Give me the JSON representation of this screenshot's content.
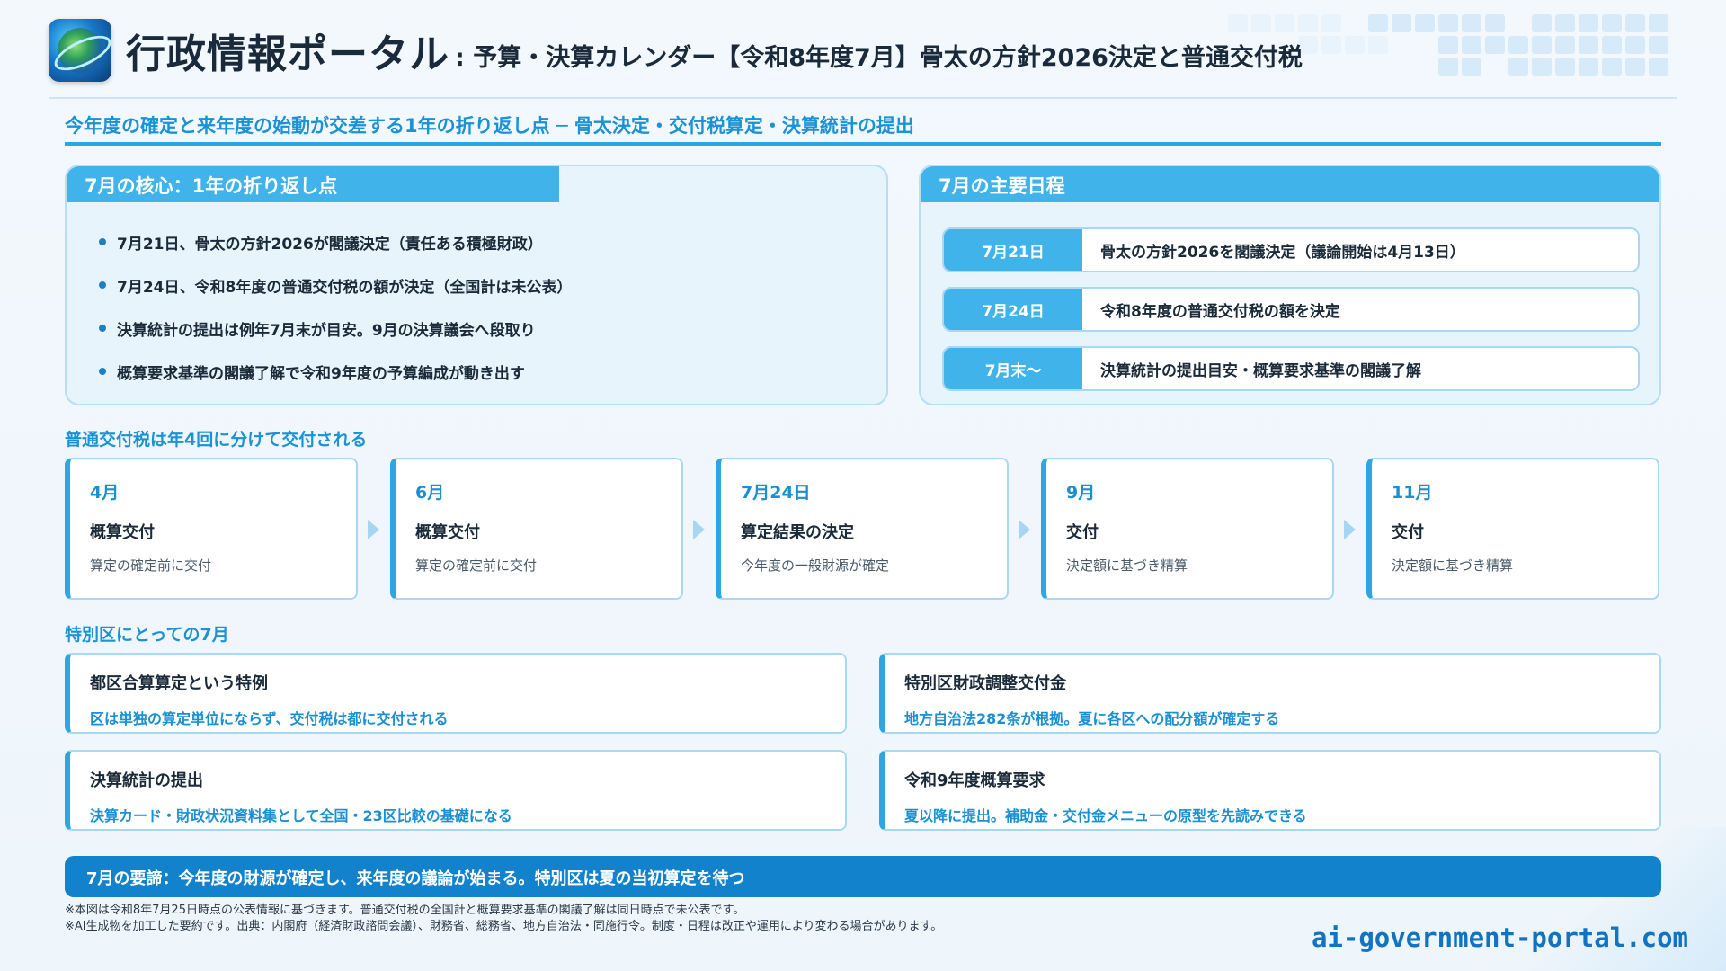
{
  "header": {
    "brand": "行政情報ポータル",
    "subtitle": ": 予算・決算カレンダー【令和8年度7月】骨太の方針2026決定と普通交付税",
    "logo_icon": "globe-logo-icon"
  },
  "tagline": "今年度の確定と来年度の始動が交差する1年の折り返し点 ─ 骨太決定・交付税算定・決算統計の提出",
  "core": {
    "heading": "7月の核心：1年の折り返し点",
    "bullets": [
      "7月21日、骨太の方針2026が閣議決定（責任ある積極財政）",
      "7月24日、令和8年度の普通交付税の額が決定（全国計は未公表）",
      "決算統計の提出は例年7月末が目安。9月の決算議会へ段取り",
      "概算要求基準の閣議了解で令和9年度の予算編成が動き出す"
    ]
  },
  "schedule": {
    "heading": "7月の主要日程",
    "rows": [
      {
        "date": "7月21日",
        "text": "骨太の方針2026を閣議決定（議論開始は4月13日）"
      },
      {
        "date": "7月24日",
        "text": "令和8年度の普通交付税の額を決定"
      },
      {
        "date": "7月末〜",
        "text": "決算統計の提出目安・概算要求基準の閣議了解"
      }
    ]
  },
  "flow": {
    "heading": "普通交付税は年4回に分けて交付される",
    "cards": [
      {
        "month": "4月",
        "title": "概算交付",
        "desc": "算定の確定前に交付"
      },
      {
        "month": "6月",
        "title": "概算交付",
        "desc": "算定の確定前に交付"
      },
      {
        "month": "7月24日",
        "title": "算定結果の決定",
        "desc": "今年度の一般財源が確定"
      },
      {
        "month": "9月",
        "title": "交付",
        "desc": "決定額に基づき精算"
      },
      {
        "month": "11月",
        "title": "交付",
        "desc": "決定額に基づき精算"
      }
    ]
  },
  "ward": {
    "heading": "特別区にとっての7月",
    "cards": [
      {
        "title": "都区合算算定という特例",
        "desc": "区は単独の算定単位にならず、交付税は都に交付される"
      },
      {
        "title": "特別区財政調整交付金",
        "desc": "地方自治法282条が根拠。夏に各区への配分額が確定する"
      },
      {
        "title": "決算統計の提出",
        "desc": "決算カード・財政状況資料集として全国・23区比較の基礎になる"
      },
      {
        "title": "令和9年度概算要求",
        "desc": "夏以降に提出。補助金・交付金メニューの原型を先読みできる"
      }
    ]
  },
  "summary": "7月の要諦：今年度の財源が確定し、来年度の議論が始まる。特別区は夏の当初算定を待つ",
  "notes": [
    "※本図は令和8年7月25日時点の公表情報に基づきます。普通交付税の全国計と概算要求基準の閣議了解は同日時点で未公表です。",
    "※AI生成物を加工した要約です。出典：内閣府（経済財政諮問会議）、財務省、総務省、地方自治法・同施行令。制度・日程は改正や運用により変わる場合があります。"
  ],
  "footer_domain": "ai-government-portal.com",
  "colors": {
    "accent": "#27a7e4",
    "header_fill": "#3fb3ea",
    "summary_bar": "#1282cc",
    "tagline": "#1a92d6"
  }
}
